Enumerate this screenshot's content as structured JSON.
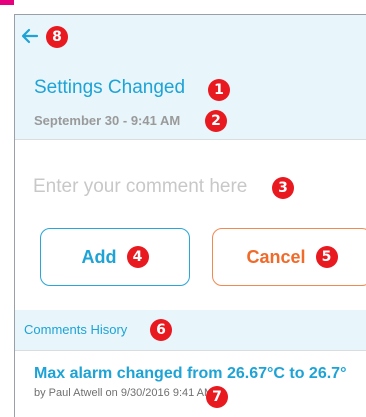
{
  "header": {
    "title": "Settings Changed",
    "date": "September 30 - 9:41 AM"
  },
  "comment": {
    "placeholder": "Enter your comment here"
  },
  "buttons": {
    "add_label": "Add",
    "cancel_label": "Cancel"
  },
  "history": {
    "label": "Comments Hisory",
    "items": [
      {
        "title": "Max alarm changed from 26.67°C to 26.7°",
        "meta": "by Paul Atwell on 9/30/2016 9:41 AM"
      }
    ]
  },
  "markers": [
    "1",
    "2",
    "3",
    "4",
    "5",
    "6",
    "7",
    "8"
  ],
  "colors": {
    "accent": "#1ea3d6",
    "cancel": "#f06a2a",
    "marker": "#e8191f",
    "header_bg": "#e8f5fb"
  }
}
